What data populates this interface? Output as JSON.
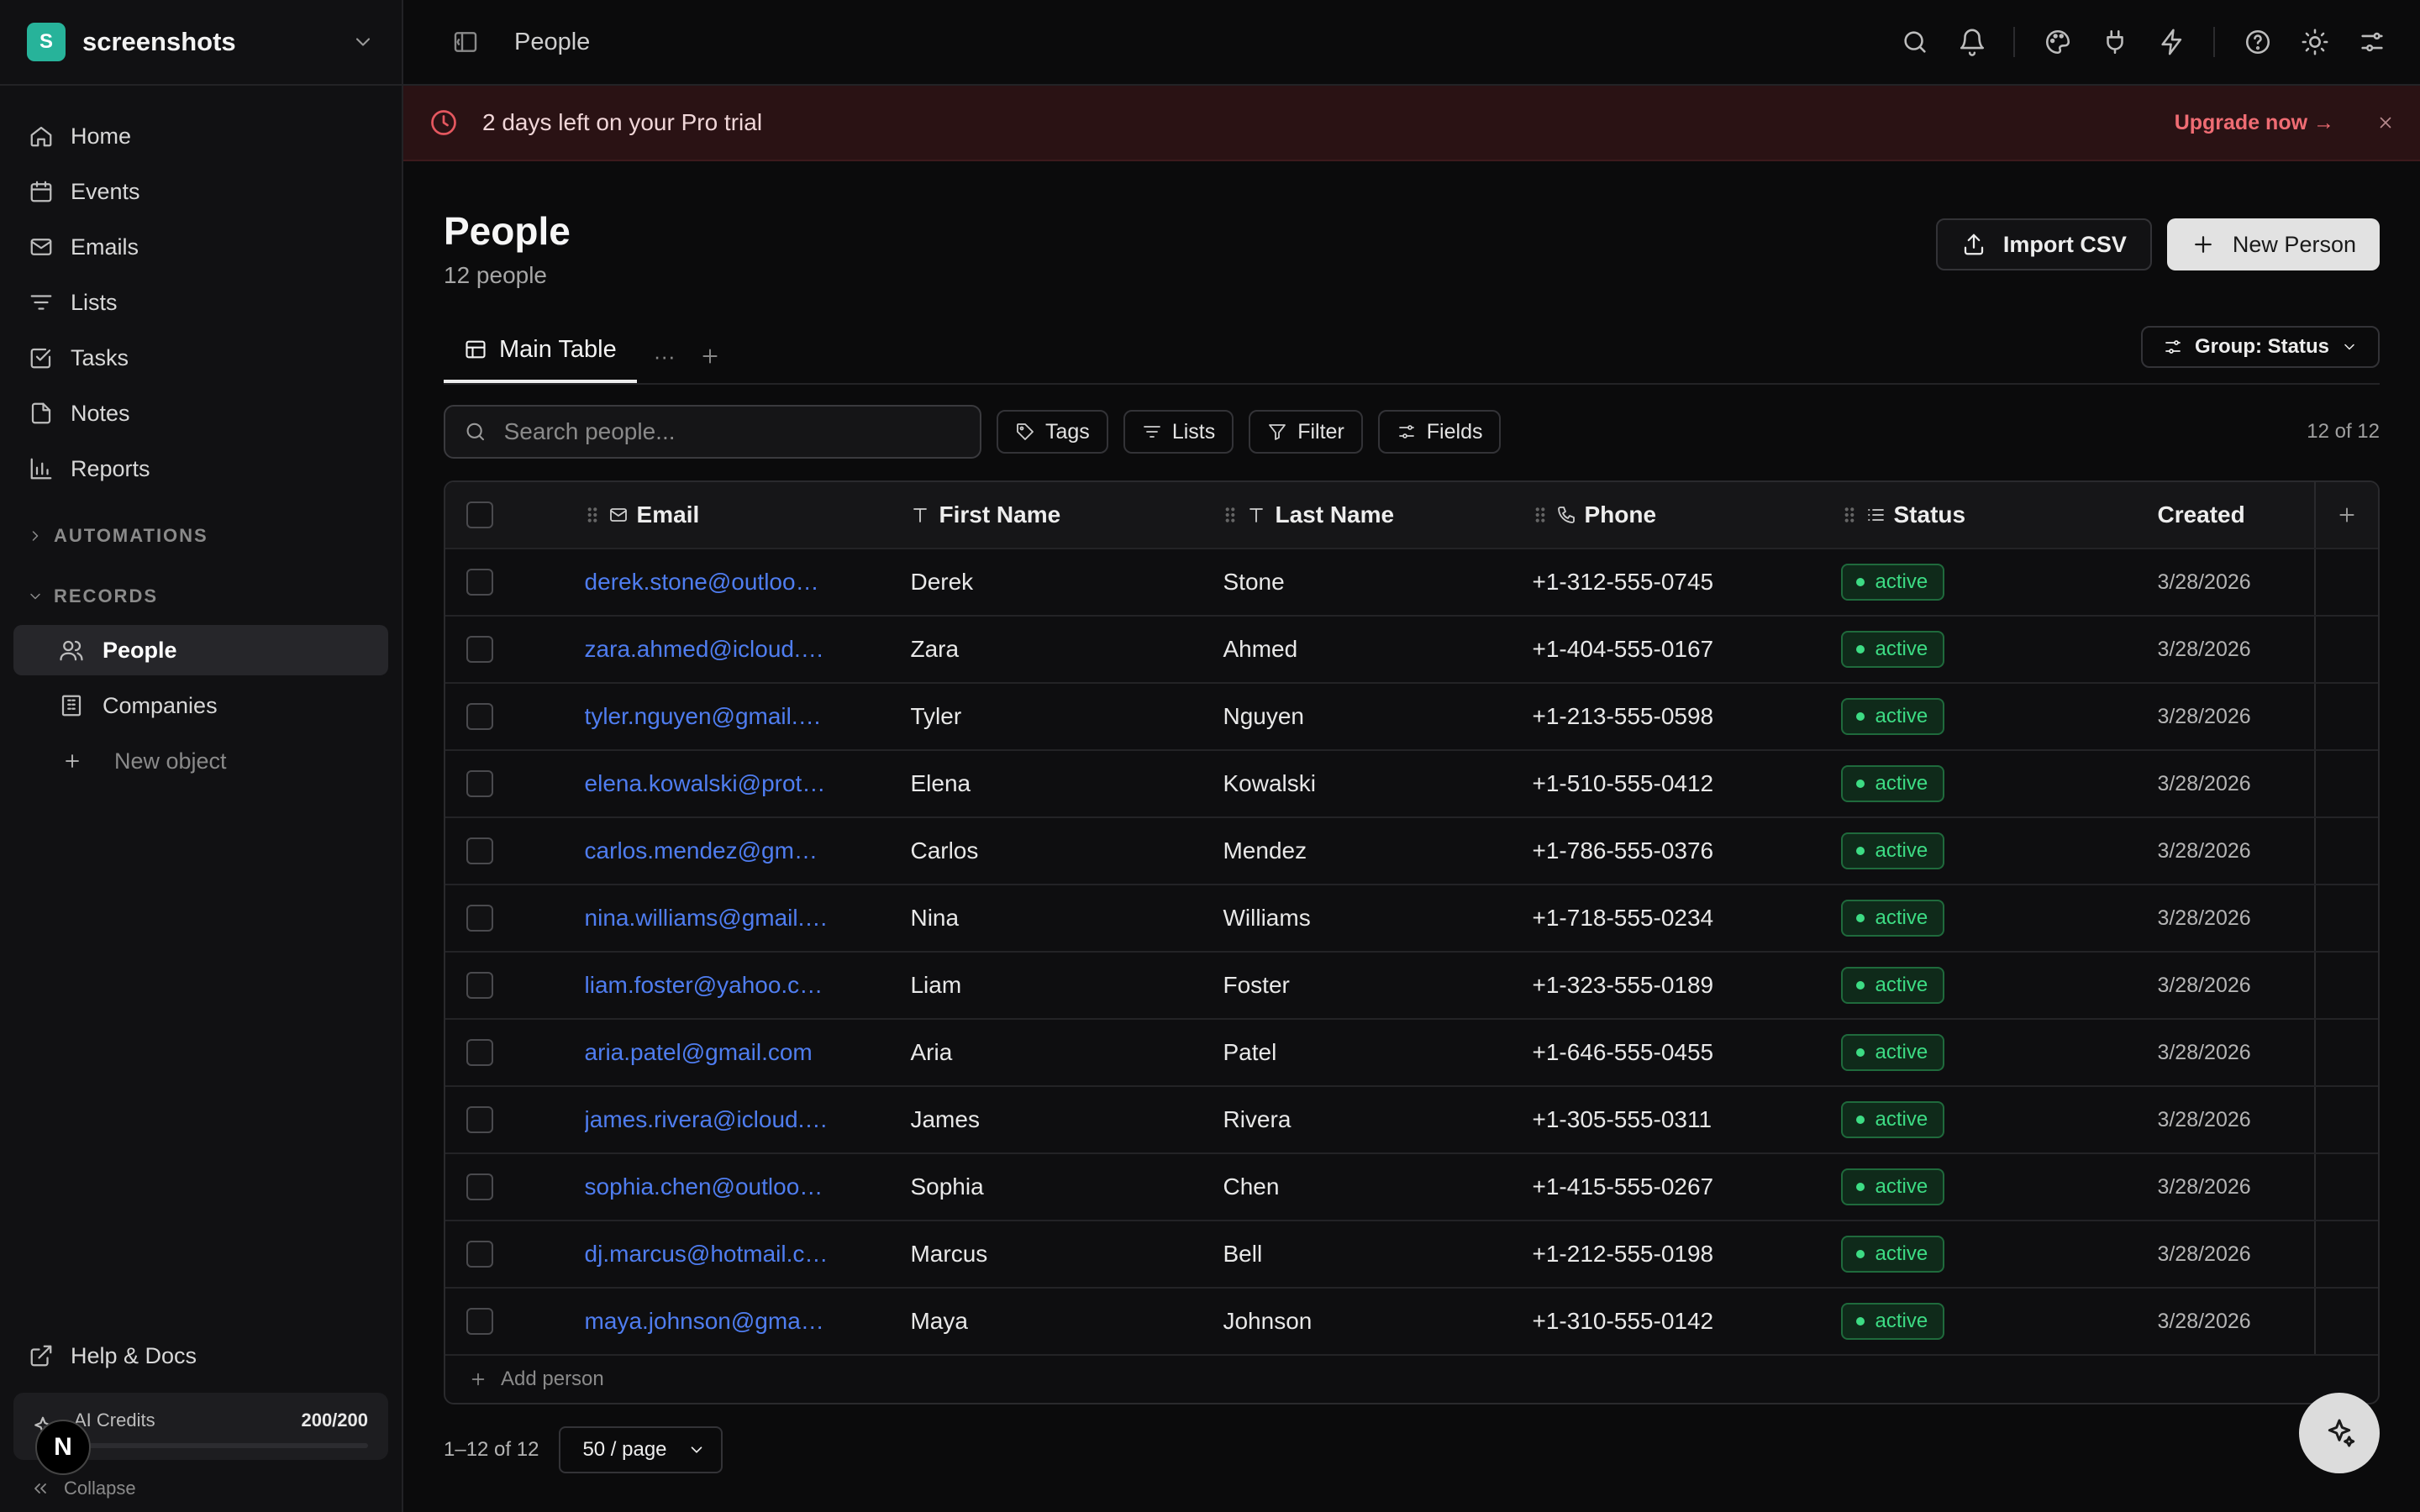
{
  "workspace": {
    "initial": "S",
    "name": "screenshots"
  },
  "sidebar": {
    "nav": [
      {
        "label": "Home",
        "icon": "home-icon"
      },
      {
        "label": "Events",
        "icon": "calendar-icon"
      },
      {
        "label": "Emails",
        "icon": "mail-icon"
      },
      {
        "label": "Lists",
        "icon": "list-filter-icon"
      },
      {
        "label": "Tasks",
        "icon": "checkbox-icon"
      },
      {
        "label": "Notes",
        "icon": "note-icon"
      },
      {
        "label": "Reports",
        "icon": "bar-chart-icon"
      }
    ],
    "automations_label": "AUTOMATIONS",
    "records_label": "RECORDS",
    "records": [
      {
        "label": "People",
        "icon": "users-icon"
      },
      {
        "label": "Companies",
        "icon": "building-icon"
      }
    ],
    "new_object": "New object",
    "help": "Help & Docs",
    "credits": {
      "label": "AI Credits",
      "value": "200/200",
      "used_fraction": 0.0
    },
    "collapse": "Collapse",
    "next_badge": "N"
  },
  "topbar": {
    "title": "People"
  },
  "banner": {
    "message": "2 days left on your Pro trial",
    "upgrade": "Upgrade now →"
  },
  "page": {
    "title": "People",
    "subtitle": "12 people",
    "import_label": "Import CSV",
    "new_label": "New Person"
  },
  "tabs": {
    "main": "Main Table",
    "more": "···",
    "group": "Group: Status"
  },
  "toolbar": {
    "search_placeholder": "Search people...",
    "tags": "Tags",
    "lists": "Lists",
    "filter": "Filter",
    "fields": "Fields",
    "count": "12 of 12"
  },
  "table": {
    "columns": {
      "email": "Email",
      "first": "First Name",
      "last": "Last Name",
      "phone": "Phone",
      "status": "Status",
      "created": "Created"
    },
    "rows": [
      {
        "email": "derek.stone@outlook.com",
        "first": "Derek",
        "last": "Stone",
        "phone": "+1-312-555-0745",
        "status": "active",
        "created": "3/28/2026"
      },
      {
        "email": "zara.ahmed@icloud.com",
        "first": "Zara",
        "last": "Ahmed",
        "phone": "+1-404-555-0167",
        "status": "active",
        "created": "3/28/2026"
      },
      {
        "email": "tyler.nguyen@gmail.com",
        "first": "Tyler",
        "last": "Nguyen",
        "phone": "+1-213-555-0598",
        "status": "active",
        "created": "3/28/2026"
      },
      {
        "email": "elena.kowalski@proton.…",
        "first": "Elena",
        "last": "Kowalski",
        "phone": "+1-510-555-0412",
        "status": "active",
        "created": "3/28/2026"
      },
      {
        "email": "carlos.mendez@gmail.c…",
        "first": "Carlos",
        "last": "Mendez",
        "phone": "+1-786-555-0376",
        "status": "active",
        "created": "3/28/2026"
      },
      {
        "email": "nina.williams@gmail.com",
        "first": "Nina",
        "last": "Williams",
        "phone": "+1-718-555-0234",
        "status": "active",
        "created": "3/28/2026"
      },
      {
        "email": "liam.foster@yahoo.com",
        "first": "Liam",
        "last": "Foster",
        "phone": "+1-323-555-0189",
        "status": "active",
        "created": "3/28/2026"
      },
      {
        "email": "aria.patel@gmail.com",
        "first": "Aria",
        "last": "Patel",
        "phone": "+1-646-555-0455",
        "status": "active",
        "created": "3/28/2026"
      },
      {
        "email": "james.rivera@icloud.com",
        "first": "James",
        "last": "Rivera",
        "phone": "+1-305-555-0311",
        "status": "active",
        "created": "3/28/2026"
      },
      {
        "email": "sophia.chen@outlook.com",
        "first": "Sophia",
        "last": "Chen",
        "phone": "+1-415-555-0267",
        "status": "active",
        "created": "3/28/2026"
      },
      {
        "email": "dj.marcus@hotmail.com",
        "first": "Marcus",
        "last": "Bell",
        "phone": "+1-212-555-0198",
        "status": "active",
        "created": "3/28/2026"
      },
      {
        "email": "maya.johnson@gmail.com",
        "first": "Maya",
        "last": "Johnson",
        "phone": "+1-310-555-0142",
        "status": "active",
        "created": "3/28/2026"
      }
    ],
    "add_row": "Add person"
  },
  "pager": {
    "range": "1–12 of 12",
    "per_page": "50 / page"
  },
  "colors": {
    "accent_link": "#4f7df0",
    "status_active": "#3ddc84",
    "banner_bg": "#2a1214",
    "workspace_logo": "#27b39a"
  }
}
